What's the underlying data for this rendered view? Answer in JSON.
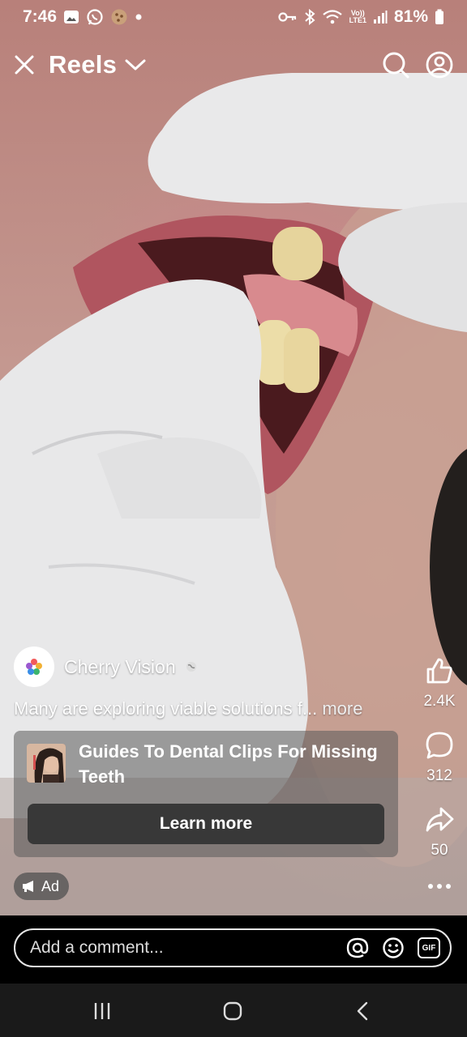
{
  "status_bar": {
    "time": "7:46",
    "battery": "81%",
    "left_icons": [
      "gallery-icon",
      "whatsapp-icon",
      "cookie-icon",
      "dot-icon"
    ],
    "right_icons": [
      "key-icon",
      "bluetooth-icon",
      "wifi-icon",
      "volte-icon",
      "signal-icon",
      "battery-icon"
    ],
    "volte_label": "Vo))\nLTE1"
  },
  "header": {
    "title": "Reels"
  },
  "post": {
    "page_name": "Cherry Vision",
    "caption": "Many are exploring viable solutions f...",
    "more_label": "more",
    "ad_title": "Guides To Dental Clips For Missing Teeth",
    "cta_label": "Learn more",
    "ad_badge": "Ad"
  },
  "actions": {
    "likes": "2.4K",
    "comments": "312",
    "shares": "50"
  },
  "comment_bar": {
    "placeholder": "Add a comment...",
    "gif_label": "GIF"
  }
}
